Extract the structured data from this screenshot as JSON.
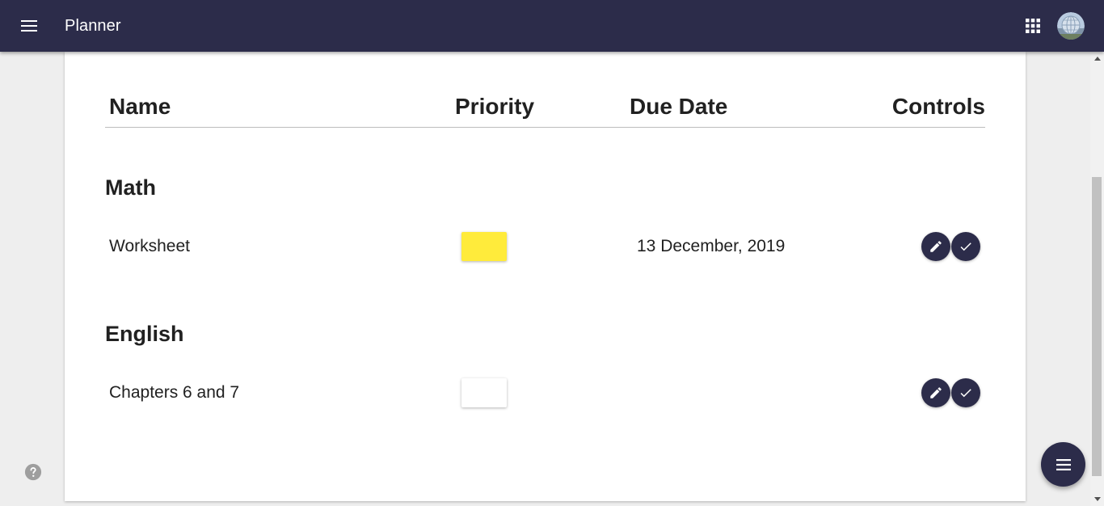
{
  "app_bar": {
    "title": "Planner",
    "menu_icon": "menu-icon",
    "apps_icon": "apps-grid-icon",
    "avatar": "user-avatar",
    "background": "#2c2c4a"
  },
  "table": {
    "headers": {
      "name": "Name",
      "priority": "Priority",
      "due_date": "Due Date",
      "controls": "Controls"
    },
    "groups": [
      {
        "title": "Math",
        "tasks": [
          {
            "name": "Worksheet",
            "priority_color": "#ffeb3b",
            "due_date": "13 December, 2019",
            "controls": [
              "edit-icon",
              "check-icon"
            ]
          }
        ]
      },
      {
        "title": "English",
        "tasks": [
          {
            "name": "Chapters 6 and 7",
            "priority_color": "#ffffff",
            "due_date": "",
            "controls": [
              "edit-icon",
              "check-icon"
            ]
          }
        ]
      }
    ]
  },
  "help_icon": "help-icon",
  "fab_icon": "list-menu-icon"
}
